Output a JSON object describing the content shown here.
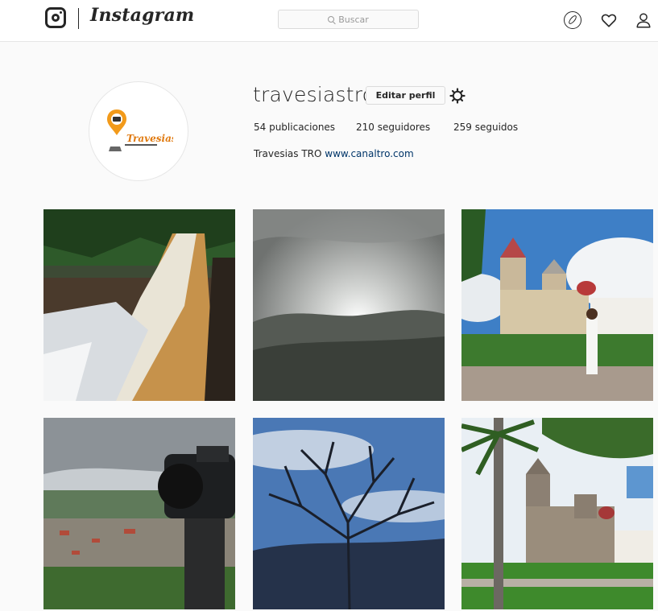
{
  "header": {
    "wordmark": "Instagram",
    "logo_icon": "instagram-camera-icon",
    "search_placeholder": "Buscar",
    "icons": [
      "compass-icon",
      "heart-icon",
      "user-icon"
    ]
  },
  "profile": {
    "username": "travesiastro",
    "edit_label": "Editar perfil",
    "settings_icon": "gear-icon",
    "stats": {
      "posts": "54 publicaciones",
      "followers": "210 seguidores",
      "following": "259 seguidos"
    },
    "bio_name": "Travesias TRO",
    "bio_link": "www.canaltro.com",
    "avatar_text": "Travesias"
  },
  "posts": [
    {
      "subject": "waterfall"
    },
    {
      "subject": "sunrise-over-mountains"
    },
    {
      "subject": "colonial-church-with-person"
    },
    {
      "subject": "camera-overlooking-town"
    },
    {
      "subject": "bare-tree-silhouette"
    },
    {
      "subject": "church-with-palm-tree"
    }
  ],
  "colors": {
    "text": "#262626",
    "link": "#003569",
    "border": "#dbdbdb",
    "background": "#fafafa"
  }
}
